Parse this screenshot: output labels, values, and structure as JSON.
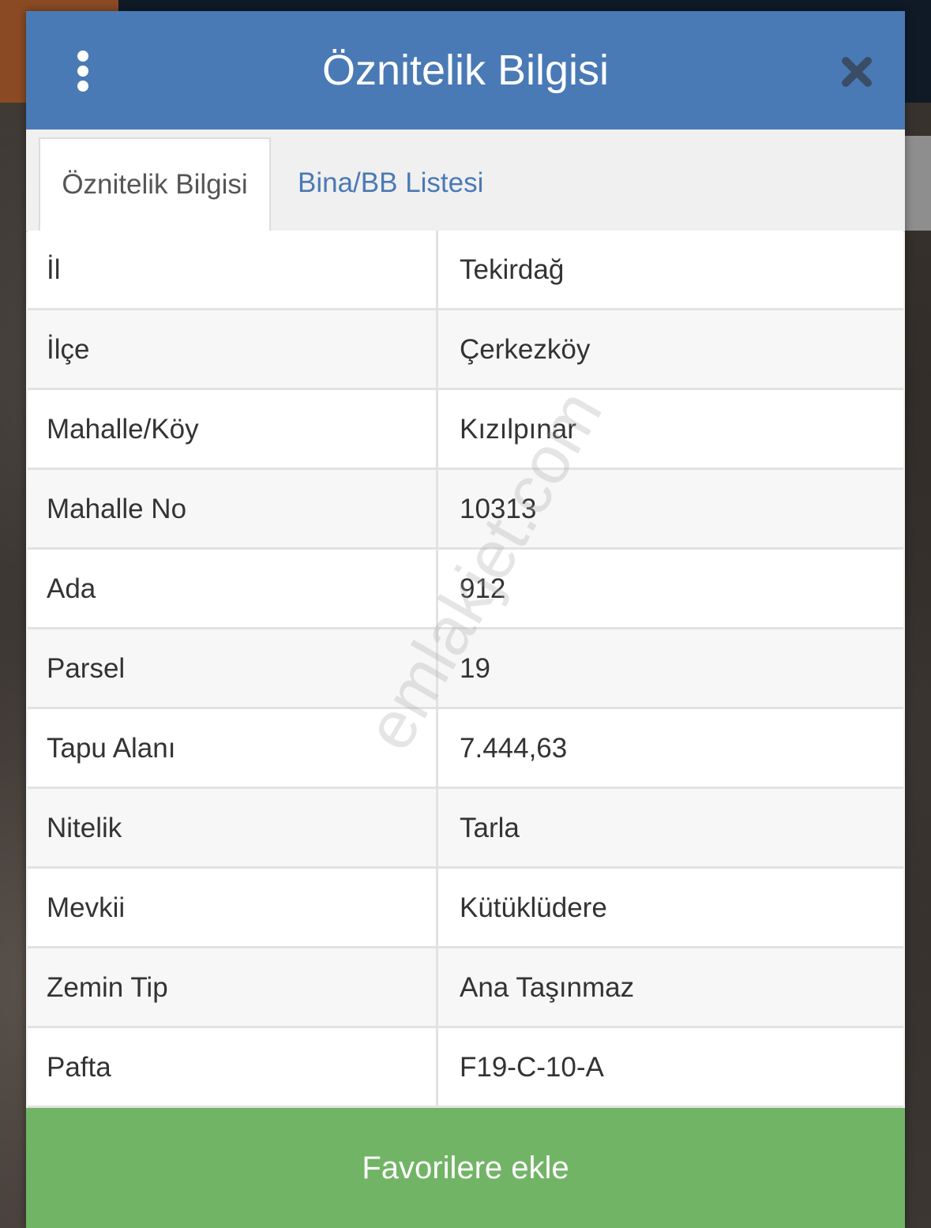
{
  "header": {
    "title": "Öznitelik Bilgisi"
  },
  "tabs": [
    {
      "label": "Öznitelik Bilgisi",
      "active": true
    },
    {
      "label": "Bina/BB Listesi",
      "active": false
    }
  ],
  "attributes": [
    {
      "label": "İl",
      "value": "Tekirdağ"
    },
    {
      "label": "İlçe",
      "value": "Çerkezköy"
    },
    {
      "label": "Mahalle/Köy",
      "value": "Kızılpınar"
    },
    {
      "label": "Mahalle No",
      "value": "10313"
    },
    {
      "label": "Ada",
      "value": "912"
    },
    {
      "label": "Parsel",
      "value": "19"
    },
    {
      "label": "Tapu Alanı",
      "value": "7.444,63"
    },
    {
      "label": "Nitelik",
      "value": "Tarla"
    },
    {
      "label": "Mevkii",
      "value": "Kütüklüdere"
    },
    {
      "label": "Zemin Tip",
      "value": "Ana Taşınmaz"
    },
    {
      "label": "Pafta",
      "value": "F19-C-10-A"
    }
  ],
  "footer": {
    "favorite_label": "Favorilere ekle"
  },
  "watermark": "emlakjet.com",
  "colors": {
    "header": "#4a7ab5",
    "tab_link": "#4a7ab5",
    "favorite_button": "#72b466"
  },
  "icons": {
    "menu": "vertical-dots-icon",
    "close": "close-icon"
  }
}
